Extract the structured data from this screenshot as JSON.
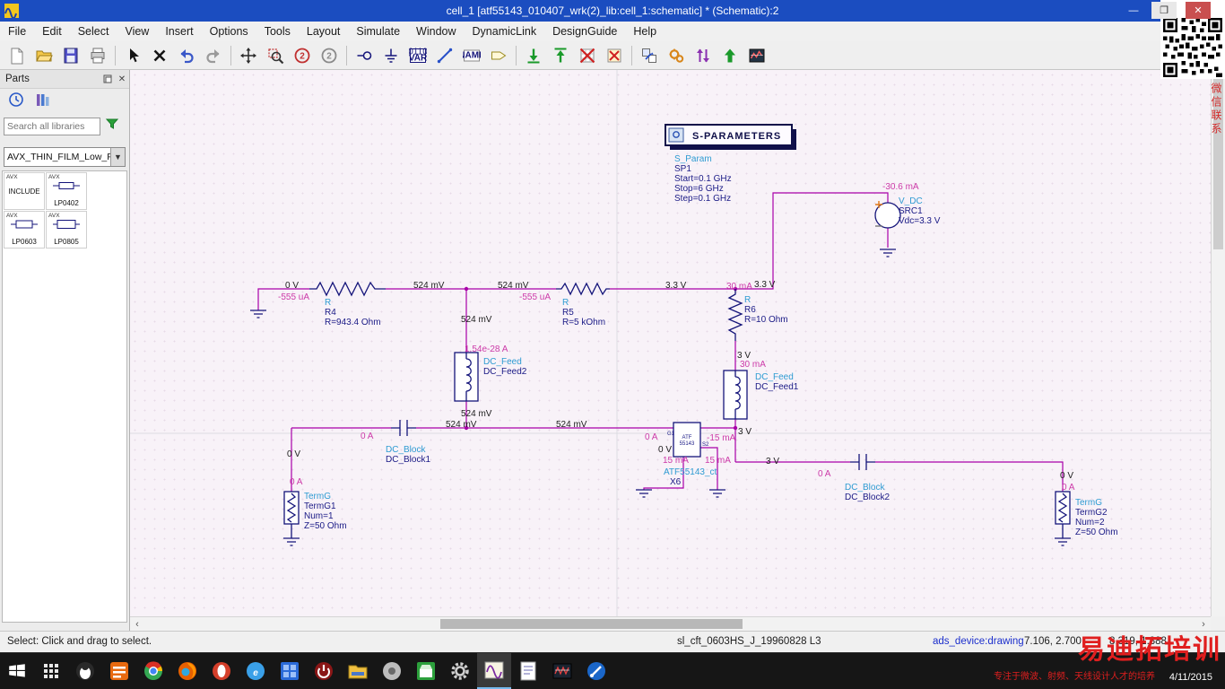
{
  "window": {
    "title": "cell_1 [atf55143_010407_wrk(2)_lib:cell_1:schematic] * (Schematic):2"
  },
  "menu": {
    "items": [
      "File",
      "Edit",
      "Select",
      "View",
      "Insert",
      "Options",
      "Tools",
      "Layout",
      "Simulate",
      "Window",
      "DynamicLink",
      "DesignGuide",
      "Help"
    ]
  },
  "toolbar": {
    "icon_text": {
      "var_top": "0110",
      "var": "VAR",
      "name": "NAME",
      "zoom2": "2"
    }
  },
  "parts": {
    "title": "Parts",
    "search_placeholder": "Search all libraries",
    "library_selected": "AVX_THIN_FILM_Low_Pa",
    "items": [
      {
        "vendor": "AVX",
        "name": "INCLUDE"
      },
      {
        "vendor": "AVX",
        "name": "LP0402"
      },
      {
        "vendor": "AVX",
        "name": "LP0603"
      },
      {
        "vendor": "AVX",
        "name": "LP0805"
      }
    ]
  },
  "schem": {
    "sp": {
      "title": "S-PARAMETERS",
      "type": "S_Param",
      "name": "SP1",
      "p1": "Start=0.1 GHz",
      "p2": "Stop=6 GHz",
      "p3": "Step=0.1 GHz"
    },
    "vdc": {
      "type": "V_DC",
      "name": "SRC1",
      "p1": "Vdc=3.3 V"
    },
    "r4": {
      "type": "R",
      "name": "R4",
      "p1": "R=943.4 Ohm"
    },
    "r5": {
      "type": "R",
      "name": "R5",
      "p1": "R=5 kOhm"
    },
    "r6": {
      "type": "R",
      "name": "R6",
      "p1": "R=10 Ohm"
    },
    "df2": {
      "type": "DC_Feed",
      "name": "DC_Feed2"
    },
    "df1": {
      "type": "DC_Feed",
      "name": "DC_Feed1"
    },
    "db1": {
      "type": "DC_Block",
      "name": "DC_Block1"
    },
    "db2": {
      "type": "DC_Block",
      "name": "DC_Block2"
    },
    "t1": {
      "type": "TermG",
      "name": "TermG1",
      "p1": "Num=1",
      "p2": "Z=50 Ohm"
    },
    "t2": {
      "type": "TermG",
      "name": "TermG2",
      "p1": "Num=2",
      "p2": "Z=50 Ohm"
    },
    "x6": {
      "box1": "ATF",
      "box2": "55143",
      "type": "ATF55143_ct",
      "name": "X6",
      "pin_g": "G1",
      "pin_s": "S2"
    },
    "ann": [
      "0 V",
      "-555 uA",
      "524 mV",
      "524 mV",
      "-555 uA",
      "3.3 V",
      "30 mA",
      "3.3 V",
      "-30.6 mA",
      "524 mV",
      "1.54e-28 A",
      "524 mV",
      "3 V",
      "30 mA",
      "0 A",
      "524 mV",
      "524 mV",
      "0 A",
      "0 V",
      "-15 mA",
      "3 V",
      "15 mA",
      "15 mA",
      "3 V",
      "0 V",
      "0 A",
      "0 A",
      "0 V",
      "0 A"
    ]
  },
  "status": {
    "message": "Select: Click and drag to select.",
    "cell_info": "sl_cft_0603HS_J_19960828 L3",
    "mode": "ads_device:drawing",
    "coord1": "7.106, 2.700",
    "coord2": "8.319, 1.388"
  },
  "overlay": {
    "wechat": "微信联系",
    "brand": "易迪拓培训",
    "slogan": "专注于微波、射频、天线设计人才的培养",
    "date": "4/11/2015"
  }
}
